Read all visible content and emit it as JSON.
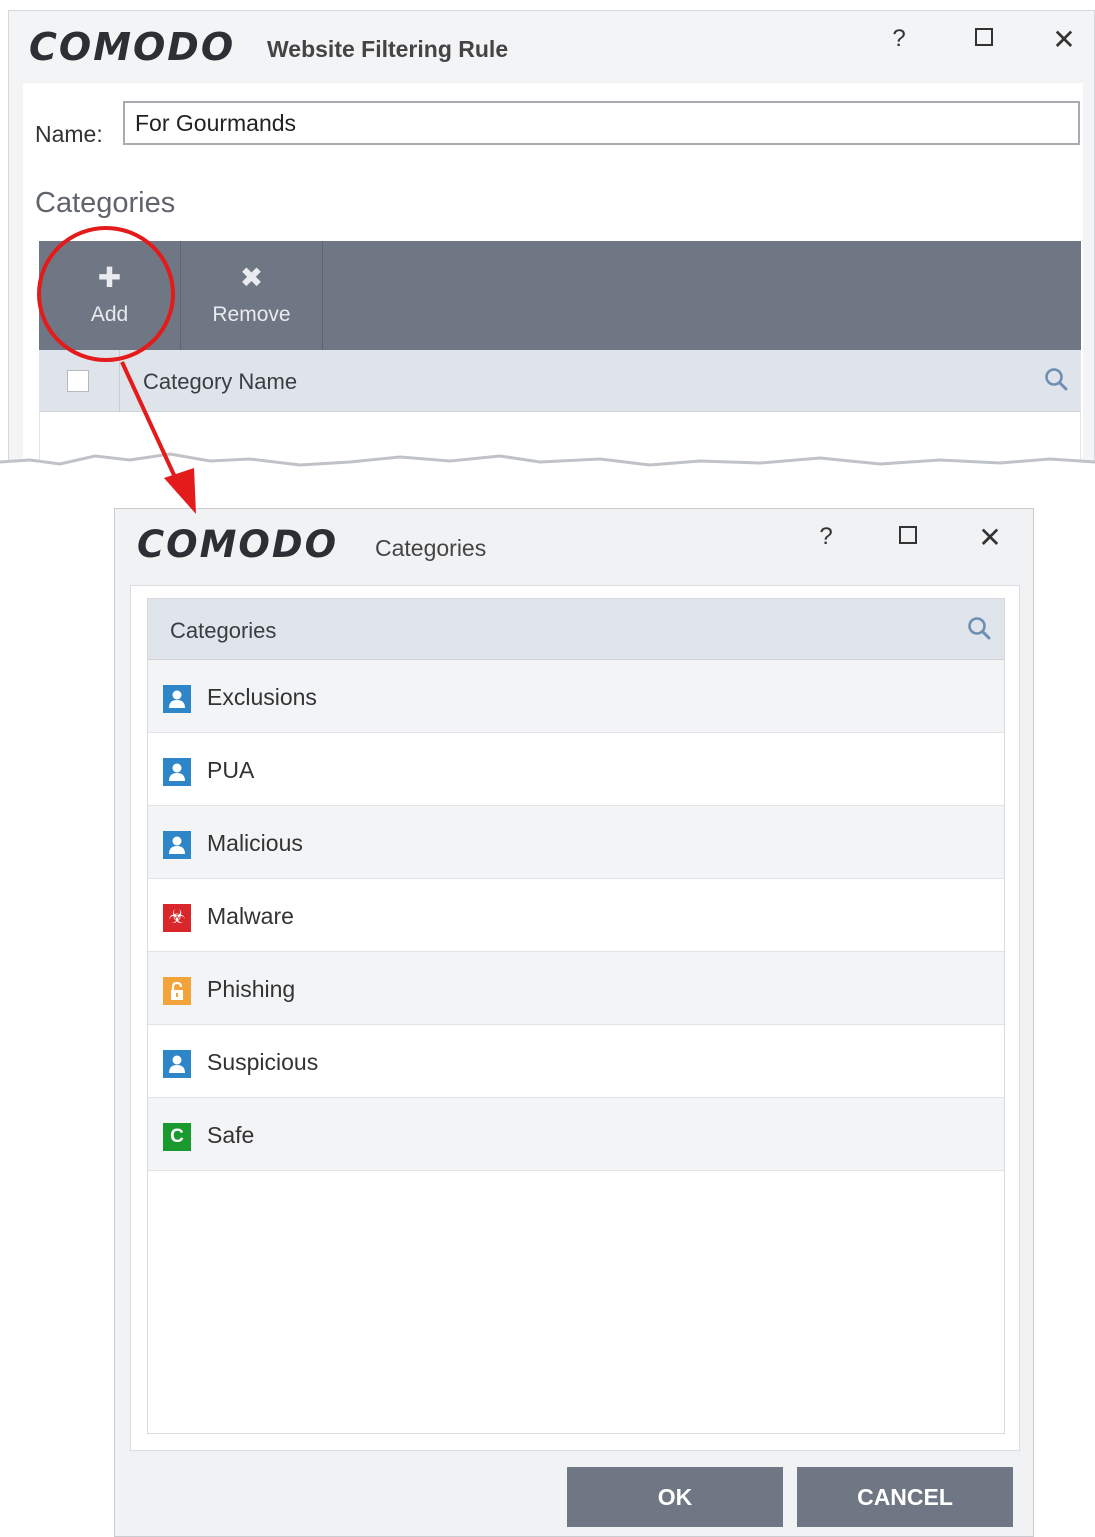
{
  "colors": {
    "toolbar": "#6f7684",
    "header": "#e0e4eb",
    "annotation": "#e31b1b"
  },
  "rule_window": {
    "logo": "COMODO",
    "title": "Website Filtering Rule",
    "controls": {
      "help": "?",
      "close": "✕"
    },
    "name_label": "Name:",
    "name_value": "For Gourmands",
    "categories_heading": "Categories",
    "toolbar": {
      "add": {
        "icon": "plus-icon",
        "label": "Add"
      },
      "remove": {
        "icon": "x-icon",
        "label": "Remove"
      }
    },
    "column_header": "Category Name"
  },
  "categories_window": {
    "logo": "COMODO",
    "title": "Categories",
    "controls": {
      "help": "?",
      "close": "✕"
    },
    "list_header": "Categories",
    "items": [
      {
        "label": "Exclusions",
        "icon": "user-icon",
        "color": "#2e86c8"
      },
      {
        "label": "PUA",
        "icon": "user-icon",
        "color": "#2e86c8"
      },
      {
        "label": "Malicious",
        "icon": "user-icon",
        "color": "#2e86c8"
      },
      {
        "label": "Malware",
        "icon": "biohazard-icon",
        "color": "#d9262a"
      },
      {
        "label": "Phishing",
        "icon": "lock-icon",
        "color": "#f2a33a"
      },
      {
        "label": "Suspicious",
        "icon": "user-icon",
        "color": "#2e86c8"
      },
      {
        "label": "Safe",
        "icon": "c-icon",
        "color": "#1a9a2e"
      }
    ],
    "ok_label": "OK",
    "cancel_label": "CANCEL"
  }
}
